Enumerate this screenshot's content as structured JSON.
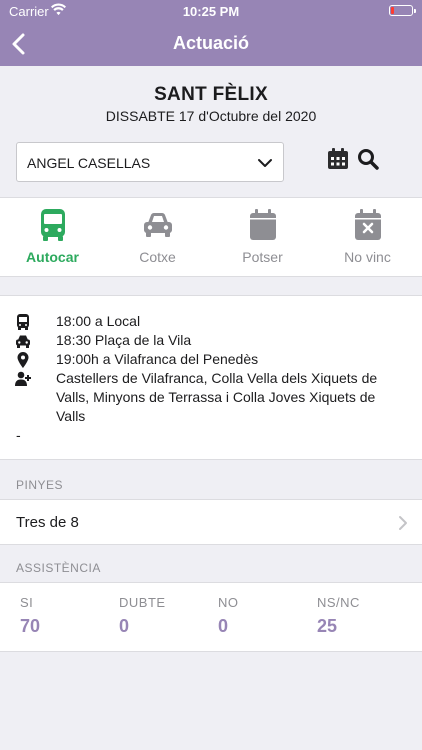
{
  "status_bar": {
    "carrier": "Carrier",
    "time": "10:25 PM"
  },
  "nav": {
    "title": "Actuació",
    "back_icon": "chevron-left-icon"
  },
  "event": {
    "title": "SANT FÈLIX",
    "date": "DISSABTE 17 d'Octubre del 2020",
    "member_select": "ANGEL CASELLAS"
  },
  "tabs": [
    {
      "label": "Autocar",
      "icon": "bus-icon",
      "active": true
    },
    {
      "label": "Cotxe",
      "icon": "car-icon",
      "active": false
    },
    {
      "label": "Potser",
      "icon": "calendar-icon",
      "active": false
    },
    {
      "label": "No vinc",
      "icon": "calendar-x-icon",
      "active": false
    }
  ],
  "info": {
    "bus": "18:00 a Local",
    "car": "18:30 Plaça de la Vila",
    "location": "19:00h a Vilafranca del Penedès",
    "groups": "Castellers de Vilafranca, Colla Vella dels Xiquets de Valls, Minyons de Terrassa i Colla Joves Xiquets de Valls",
    "notes": "-"
  },
  "pinyes": {
    "header": "PINYES",
    "value": "Tres de 8"
  },
  "assistencia": {
    "header": "ASSISTÈNCIA",
    "columns": [
      {
        "label": "SI",
        "value": "70"
      },
      {
        "label": "DUBTE",
        "value": "0"
      },
      {
        "label": "NO",
        "value": "0"
      },
      {
        "label": "NS/NC",
        "value": "25"
      }
    ]
  },
  "colors": {
    "accent": "#9785b5",
    "active_green": "#2daa5e",
    "inactive": "#8e8e93"
  }
}
